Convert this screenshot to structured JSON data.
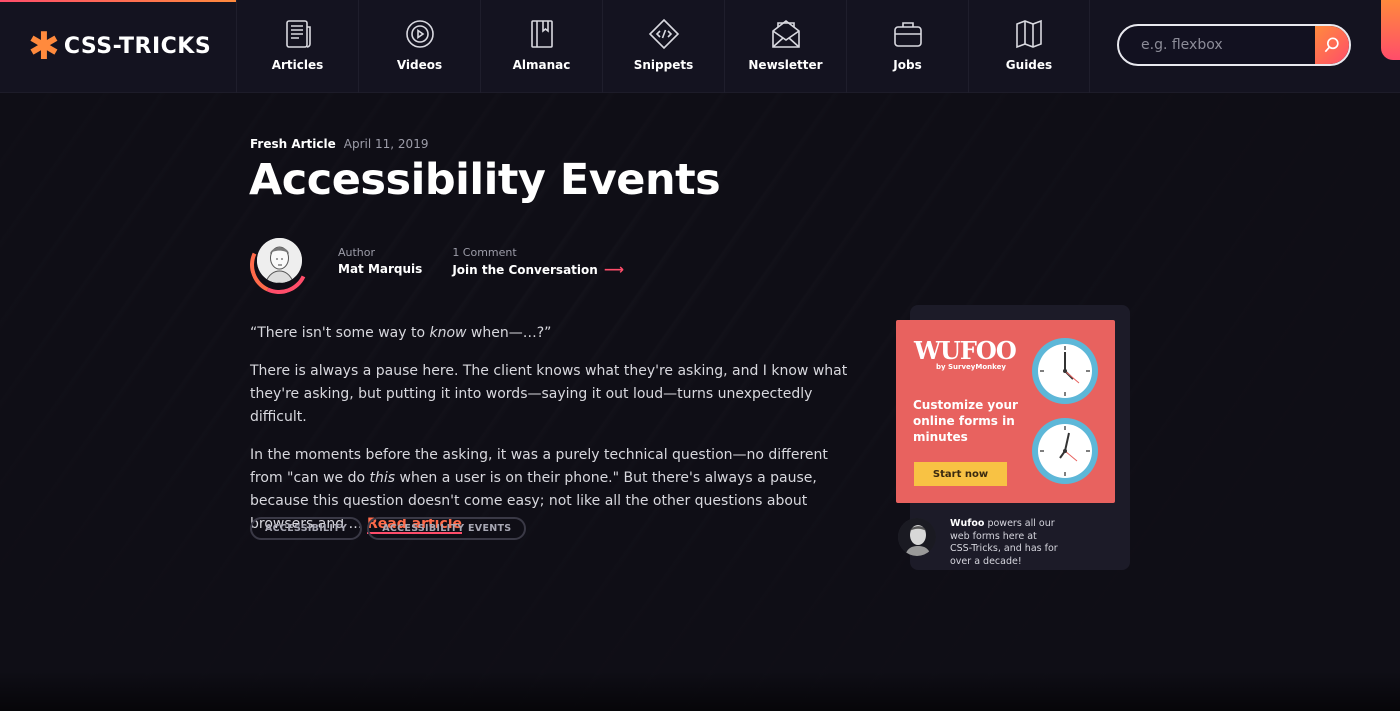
{
  "site": {
    "logo_text": "CSS-TRICKS",
    "accent": "#ff4d6a",
    "accent2": "#ff8a3d"
  },
  "nav": {
    "items": [
      {
        "label": "Articles",
        "icon": "newspaper-icon"
      },
      {
        "label": "Videos",
        "icon": "play-circle-icon"
      },
      {
        "label": "Almanac",
        "icon": "book-icon"
      },
      {
        "label": "Snippets",
        "icon": "code-diamond-icon"
      },
      {
        "label": "Newsletter",
        "icon": "envelope-icon"
      },
      {
        "label": "Jobs",
        "icon": "briefcase-icon"
      },
      {
        "label": "Guides",
        "icon": "map-icon"
      }
    ]
  },
  "search": {
    "placeholder": "e.g. flexbox",
    "value": ""
  },
  "article": {
    "tagline": "Fresh Article",
    "date": "April 11, 2019",
    "title": "Accessibility Events",
    "author_label": "Author",
    "author_name": "Mat Marquis",
    "comments_label": "1 Comment",
    "comments_link": "Join the Conversation",
    "quote_pre": "“There isn't some way to ",
    "quote_em": "know",
    "quote_post": " when—…?”",
    "para2": "There is always a pause here. The client knows what they're asking, and I know what they're asking, but putting it into words—saying it out loud—turns unexpectedly difficult.",
    "para3_pre": "In the moments before the asking, it was a purely technical question—no different from \"can we do ",
    "para3_em": "this",
    "para3_post": " when a user is on their phone.\" But there's always a pause, because this question doesn't come easy; not like all the other questions about browsers and … ",
    "read_more": "Read article",
    "tags": [
      "ACCESSIBILITY",
      "ACCESSIBILITY EVENTS"
    ]
  },
  "ad": {
    "brand": "WUFOO",
    "brand_sub": "by SurveyMonkey",
    "headline": "Customize your online forms in minutes",
    "cta": "Start now",
    "foot_brand": "Wufoo",
    "foot_text": " powers all our web forms here at CSS-Tricks, and has for over a decade!"
  }
}
